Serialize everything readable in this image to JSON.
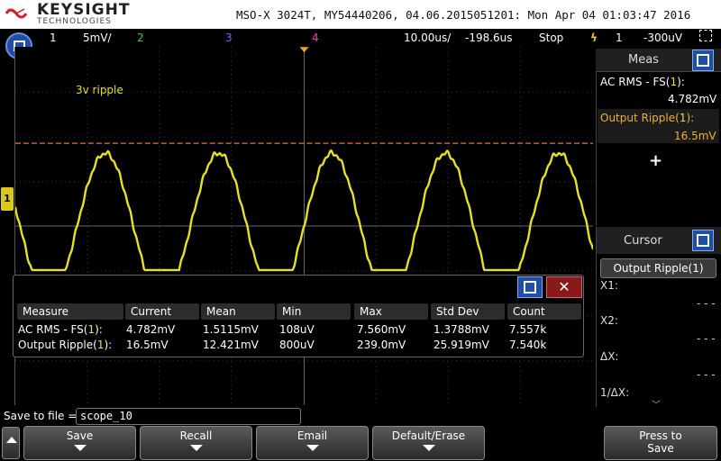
{
  "header": {
    "brand": "KEYSIGHT",
    "brand_sub": "TECHNOLOGIES",
    "info": "MSO-X 3024T, MY54440206, 04.06.2015051201: Mon Apr 04 01:03:47 2016"
  },
  "status": {
    "ch1_num": "1",
    "ch1_scale": "5mV/",
    "ch2_num": "2",
    "ch3_num": "3",
    "ch4_num": "4",
    "timebase": "10.00us/",
    "delay": "-198.6us",
    "run_state": "Stop",
    "trigger_source": "1",
    "trigger_level": "-300uV"
  },
  "waveform": {
    "annotation": "3v ripple",
    "color": "#e8e020",
    "ref_line_color": "#e87050"
  },
  "meas_panel": {
    "title": "Meas",
    "m1_label_prefix": "AC RMS - FS(",
    "m1_label_ch": "1",
    "m1_label_suffix": "):",
    "m1_value": "4.782mV",
    "m2_label_prefix": "Output Ripple(",
    "m2_label_ch": "1",
    "m2_label_suffix": "):",
    "m2_value": "16.5mV",
    "add": "+"
  },
  "cursor_panel": {
    "title": "Cursor",
    "source": "Output Ripple(1)",
    "x1_label": "X1:",
    "x1_value": "- - -",
    "x2_label": "X2:",
    "x2_value": "- - -",
    "dx_label": "ΔX:",
    "dx_value": "- - -",
    "inv_dx_label": "1/ΔX:"
  },
  "meas_table": {
    "close": "✕",
    "columns": [
      "Measure",
      "Current",
      "Mean",
      "Min",
      "Max",
      "Std Dev",
      "Count"
    ],
    "rows": [
      [
        "AC RMS - FS(1):",
        "4.782mV",
        "1.5115mV",
        "108uV",
        "7.560mV",
        "1.3788mV",
        "7.557k"
      ],
      [
        "Output Ripple(1):",
        "16.5mV",
        "12.421mV",
        "800uV",
        "239.0mV",
        "25.919mV",
        "7.540k"
      ]
    ]
  },
  "save": {
    "label": "Save to file =",
    "filename": "scope_10"
  },
  "softkeys": {
    "save": "Save",
    "recall": "Recall",
    "email": "Email",
    "default_erase": "Default/Erase",
    "press_to": "Press to",
    "press_save": "Save"
  },
  "colors": {
    "ch1": "#f0e020",
    "ch2": "#30d030",
    "ch3": "#5878ff",
    "ch4": "#f040b0",
    "accent_blue": "#1e4fa8",
    "highlight": "#f0b030"
  }
}
